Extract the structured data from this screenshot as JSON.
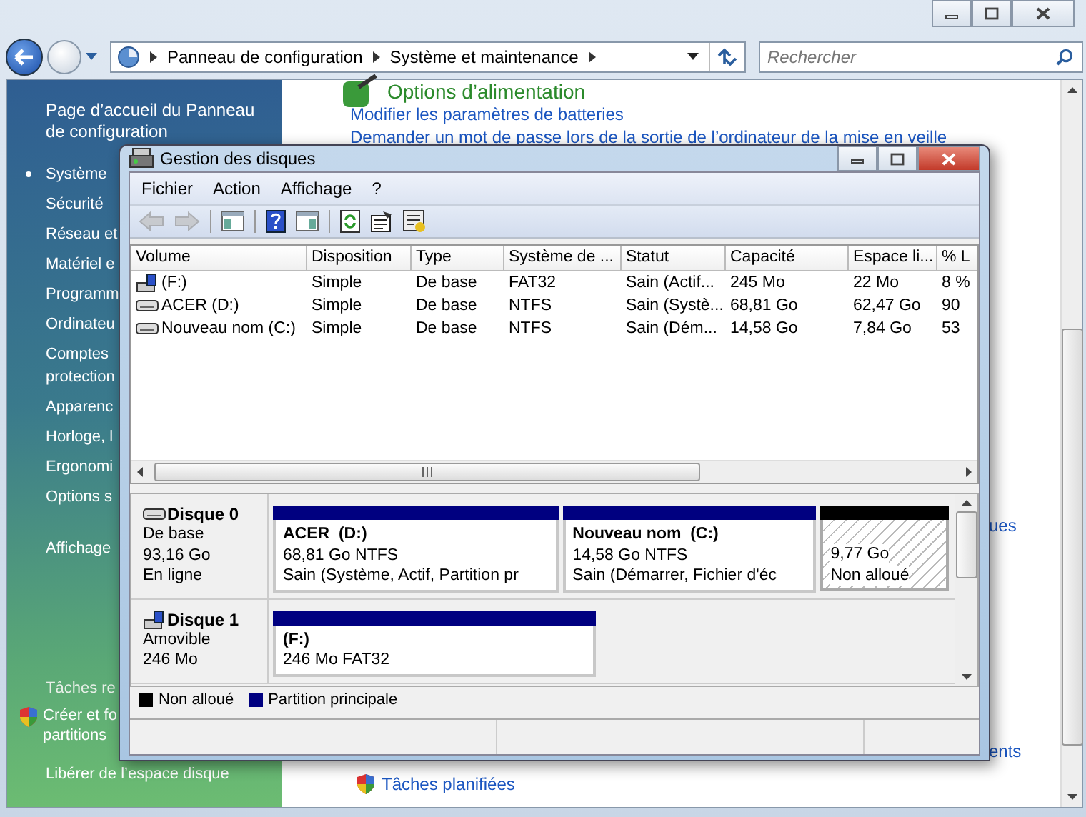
{
  "explorer": {
    "breadcrumb": [
      "Panneau de configuration",
      "Système et maintenance"
    ],
    "search": {
      "placeholder": "Rechercher"
    },
    "sidebar": {
      "home": "Page d’accueil du Panneau de configuration",
      "items": [
        {
          "label": "Système",
          "selected": true
        },
        {
          "label": "Sécurité",
          "selected": false
        },
        {
          "label": "Réseau et",
          "selected": false
        },
        {
          "label": "Matériel e",
          "selected": false
        },
        {
          "label": "Programm",
          "selected": false
        },
        {
          "label": "Ordinateu",
          "selected": false
        },
        {
          "label": "Comptes\nprotection",
          "selected": false
        },
        {
          "label": "Apparenc",
          "selected": false
        },
        {
          "label": "Horloge, l",
          "selected": false
        },
        {
          "label": "Ergonomi",
          "selected": false
        },
        {
          "label": "Options s",
          "selected": false
        },
        {
          "label": "Affichage",
          "selected": false
        }
      ],
      "tasks_heading": "Tâches re",
      "tasks": [
        {
          "label": "Créer et fo\npartitions",
          "shield": true
        },
        {
          "label": "Libérer de l’espace disque",
          "shield": false
        }
      ]
    },
    "content": {
      "heading": "Options d’alimentation",
      "links": [
        "Modifier les paramètres de batteries",
        "Demander un mot de passe lors de la sortie de l’ordinateur de la mise en veille"
      ],
      "fragment_upper": "ues",
      "fragment_lower": "ents",
      "bottom_link": "Tâches planifiées"
    }
  },
  "dialog": {
    "title": "Gestion des disques",
    "menu": [
      "Fichier",
      "Action",
      "Affichage",
      "?"
    ],
    "toolbar": [
      {
        "kind": "back",
        "disabled": true
      },
      {
        "kind": "forward",
        "disabled": true
      },
      {
        "kind": "separator"
      },
      {
        "kind": "tree"
      },
      {
        "kind": "separator"
      },
      {
        "kind": "help"
      },
      {
        "kind": "pane"
      },
      {
        "kind": "separator"
      },
      {
        "kind": "refresh"
      },
      {
        "kind": "properties"
      },
      {
        "kind": "wizard"
      }
    ],
    "table": {
      "columns": [
        "Volume",
        "Disposition",
        "Type",
        "Système de ...",
        "Statut",
        "Capacité",
        "Espace li...",
        "% L"
      ],
      "rows": [
        {
          "kind": "removable",
          "cells": [
            "(F:)",
            "Simple",
            "De base",
            "FAT32",
            "Sain (Actif...",
            "245 Mo",
            "22 Mo",
            "8 %"
          ]
        },
        {
          "kind": "fixed",
          "cells": [
            "ACER (D:)",
            "Simple",
            "De base",
            "NTFS",
            "Sain (Systè...",
            "68,81 Go",
            "62,47 Go",
            "90"
          ]
        },
        {
          "kind": "fixed",
          "cells": [
            "Nouveau nom (C:)",
            "Simple",
            "De base",
            "NTFS",
            "Sain (Dém...",
            "14,58 Go",
            "7,84 Go",
            "53"
          ]
        }
      ]
    },
    "disks": [
      {
        "name": "Disque 0",
        "kind": "fixed",
        "lines": [
          "De base",
          "93,16 Go",
          "En ligne"
        ],
        "partitions": [
          {
            "kind": "primary",
            "title": "ACER  (D:)",
            "lines": [
              "68,81 Go NTFS",
              "Sain (Système, Actif, Partition pr"
            ]
          },
          {
            "kind": "primary",
            "title": "Nouveau nom  (C:)",
            "lines": [
              "14,58 Go NTFS",
              "Sain (Démarrer, Fichier d'éc"
            ]
          },
          {
            "kind": "unallocated",
            "lines": [
              "9,77 Go",
              "Non alloué"
            ]
          }
        ]
      },
      {
        "name": "Disque 1",
        "kind": "removable",
        "lines": [
          "Amovible",
          "246 Mo"
        ],
        "partitions": [
          {
            "kind": "primary",
            "title": "(F:)",
            "lines": [
              "246 Mo FAT32"
            ]
          }
        ]
      }
    ],
    "legend": [
      {
        "label": "Non alloué",
        "color": "#000000"
      },
      {
        "label": "Partition principale",
        "color": "#000080"
      }
    ]
  }
}
